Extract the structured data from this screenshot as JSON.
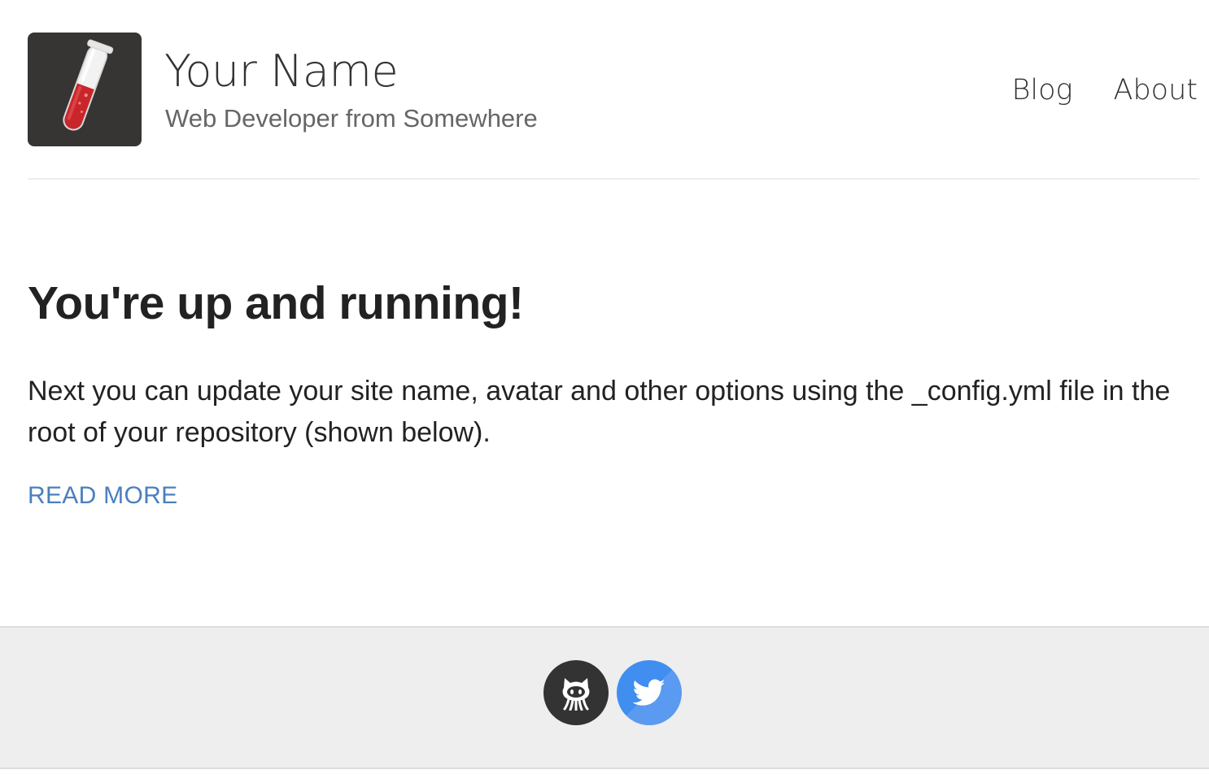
{
  "header": {
    "site_title": "Your Name",
    "site_description": "Web Developer from Somewhere",
    "avatar_icon": "test-tube-icon",
    "nav": [
      {
        "label": "Blog"
      },
      {
        "label": "About"
      }
    ]
  },
  "post": {
    "title": "You're up and running!",
    "excerpt": "Next you can update your site name, avatar and other options using the _config.yml file in the root of your repository (shown below).",
    "read_more_label": "READ MORE"
  },
  "footer": {
    "social": [
      {
        "name": "github",
        "icon": "github-octocat-icon",
        "color": "#333333"
      },
      {
        "name": "twitter",
        "icon": "twitter-bird-icon",
        "color": "#4d90e8"
      }
    ]
  },
  "colors": {
    "link": "#4a7fbf",
    "avatar_bg": "#363533",
    "footer_bg": "#eeeeee",
    "test_tube_liquid": "#c8262b"
  }
}
